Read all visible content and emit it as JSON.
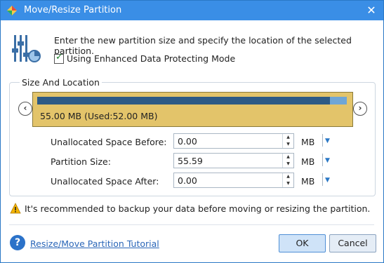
{
  "window": {
    "title": "Move/Resize Partition",
    "close_glyph": "✕"
  },
  "header": {
    "icon": "sliders-icon",
    "instruction": "Enter the new partition size and specify the location of the selected partition.",
    "enhanced_mode": {
      "label": "Using Enhanced Data Protecting Mode",
      "checked": true
    }
  },
  "size_location": {
    "legend": "Size And Location",
    "partition_label": "55.00 MB (Used:52.00 MB)",
    "used_fraction": 0.945,
    "nav_left": "‹",
    "nav_right": "›",
    "rows": [
      {
        "label": "Unallocated Space Before:",
        "value": "0.00",
        "unit": "MB"
      },
      {
        "label": "Partition Size:",
        "value": "55.59",
        "unit": "MB"
      },
      {
        "label": "Unallocated Space After:",
        "value": "0.00",
        "unit": "MB"
      }
    ]
  },
  "warning_text": "It's recommended to backup your data before moving or resizing the partition.",
  "footer": {
    "tutorial_link": "Resize/Move Partition Tutorial",
    "ok_label": "OK",
    "cancel_label": "Cancel"
  },
  "colors": {
    "titlebar": "#3a8ee6",
    "partition": "#e3c46a",
    "used_bar": "#2d5a85",
    "free_bar": "#6fa6d6"
  }
}
